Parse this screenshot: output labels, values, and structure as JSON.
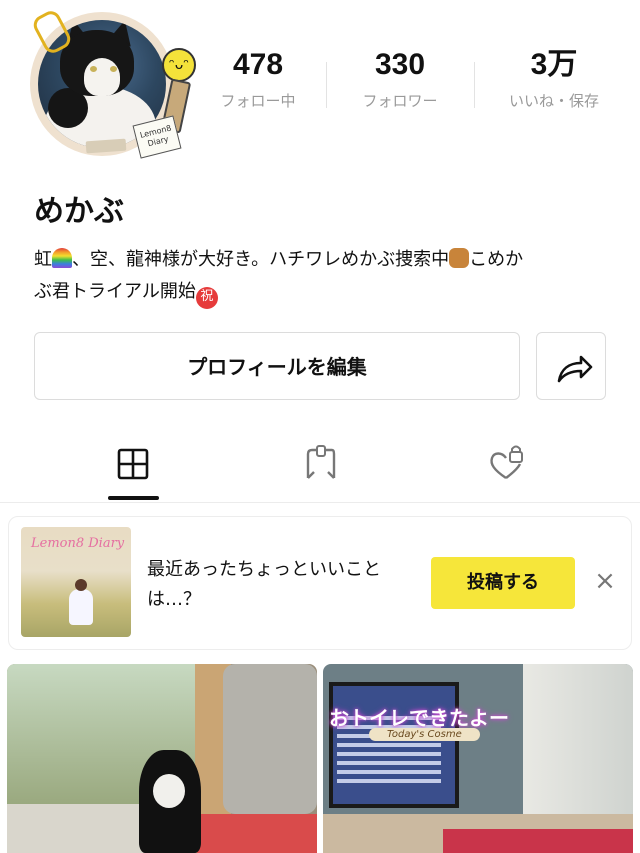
{
  "profile": {
    "name": "めかぶ",
    "avatar_note": "Lemon8 Diary",
    "bio_parts": [
      "虹",
      "、空、龍神様が大好き。ハチワレめかぶ捜索中",
      "こめか",
      "ぶ君トライアル開始"
    ],
    "bio_badge": "祝"
  },
  "stats": [
    {
      "value": "478",
      "label": "フォロー中"
    },
    {
      "value": "330",
      "label": "フォロワー"
    },
    {
      "value": "3万",
      "label": "いいね・保存"
    }
  ],
  "actions": {
    "edit_profile": "プロフィールを編集",
    "share_icon": "share-arrow-icon"
  },
  "tabs": [
    {
      "icon": "grid-icon",
      "selected": true
    },
    {
      "icon": "bookmark-icon",
      "selected": false
    },
    {
      "icon": "heart-lock-icon",
      "selected": false
    }
  ],
  "banner": {
    "thumb_title": "Lemon8 Diary",
    "prompt": "最近あったちょっといいことは…？",
    "post_button": "投稿する",
    "close_icon": "close-icon"
  },
  "posts": [
    {
      "overlay_title": "",
      "overlay_sub": ""
    },
    {
      "overlay_title": "おトイレできたよー",
      "overlay_sub": "Today's Cosme"
    }
  ],
  "colors": {
    "accent_yellow": "#f6e63a",
    "muted_text": "#9a9a9a",
    "border": "#dcdcdc"
  }
}
